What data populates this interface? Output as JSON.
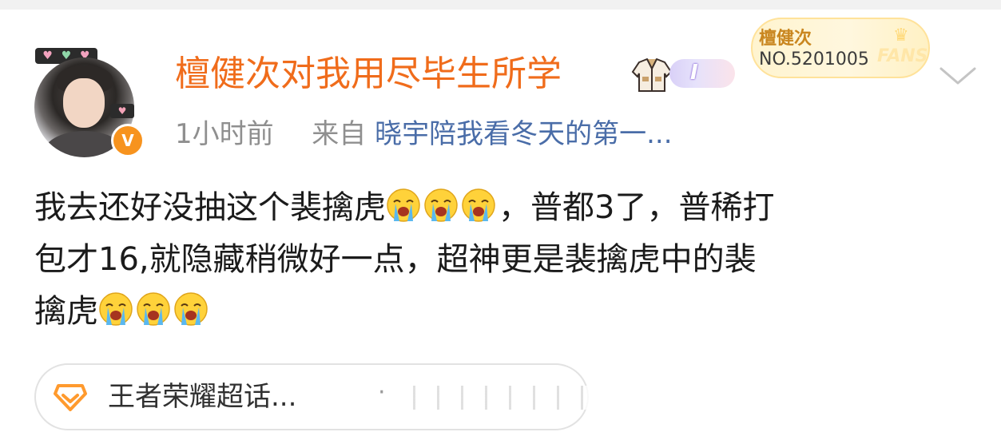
{
  "post": {
    "username": "檀健次对我用尽毕生所学",
    "level_badge": "I",
    "time": "1小时前",
    "from_prefix": "来自",
    "source": "晓宇陪我看冬天的第一...",
    "content": {
      "line1_text": "我去还好没抽这个裴擒虎",
      "line1_suffix": "，普都3了，普稀打",
      "line2": "包才16,就隐藏稍微好一点，超神更是裴擒虎中的裴",
      "line3_text": "擒虎"
    }
  },
  "fans_card": {
    "name": "檀健次",
    "number": "NO.5201005",
    "label": "FANS"
  },
  "topic": {
    "label": "王者荣耀超话...",
    "separator": "·"
  },
  "icons": {
    "avatar": "user-avatar",
    "verified": "verified-v-icon",
    "jacket": "jacket-badge-icon",
    "chevron": "chevron-down-icon",
    "emoji": "crying-emoji-icon",
    "topic": "diamond-topic-icon"
  },
  "colors": {
    "username": "#f06c1b",
    "meta": "#8f8f8f",
    "source_link": "#4a6da8",
    "text": "#1b1b1b",
    "verified": "#f7931e"
  }
}
